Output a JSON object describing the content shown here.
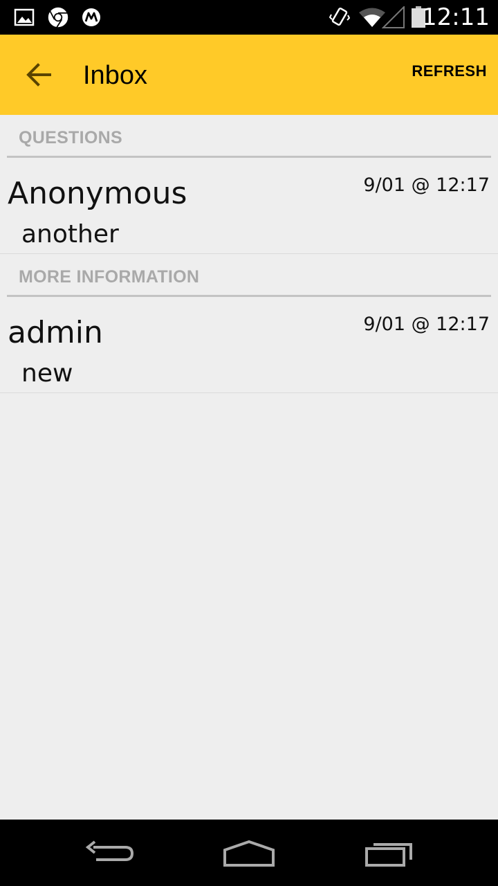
{
  "status_bar": {
    "time": "12:11",
    "icons": [
      "gallery-icon",
      "chrome-icon",
      "motorola-icon",
      "vibrate-icon",
      "wifi-icon",
      "signal-icon",
      "battery-icon"
    ]
  },
  "action_bar": {
    "title": "Inbox",
    "refresh_label": "REFRESH",
    "color": "#ffca28"
  },
  "sections": [
    {
      "header": "QUESTIONS",
      "messages": [
        {
          "sender": "Anonymous",
          "preview": "another",
          "timestamp": "9/01 @ 12:17"
        }
      ]
    },
    {
      "header": "MORE INFORMATION",
      "messages": [
        {
          "sender": "admin",
          "preview": "new",
          "timestamp": "9/01 @ 12:17"
        }
      ]
    }
  ],
  "nav_bar": {
    "icons": [
      "back-icon",
      "home-icon",
      "recents-icon"
    ]
  }
}
